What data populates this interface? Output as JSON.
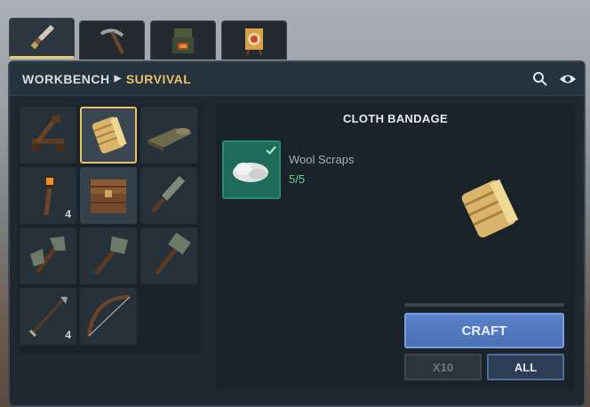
{
  "tabs": [
    {
      "icon": "knife-icon",
      "active": true
    },
    {
      "icon": "pickaxe-icon",
      "active": false
    },
    {
      "icon": "furnace-icon",
      "active": false
    },
    {
      "icon": "target-icon",
      "active": false
    }
  ],
  "breadcrumb": {
    "parent": "WORKBENCH",
    "current": "SURVIVAL"
  },
  "header_icons": [
    "search-icon",
    "eye-icon"
  ],
  "recipe_slots": [
    {
      "item": "catapult",
      "count": ""
    },
    {
      "item": "cloth-bandage",
      "count": "",
      "selected": true
    },
    {
      "item": "bedroll",
      "count": ""
    },
    {
      "item": "torch",
      "count": "4"
    },
    {
      "item": "storage-chest",
      "count": ""
    },
    {
      "item": "stone-knife",
      "count": ""
    },
    {
      "item": "stone-axe",
      "count": ""
    },
    {
      "item": "stone-shovel",
      "count": ""
    },
    {
      "item": "stone-hammer",
      "count": ""
    },
    {
      "item": "arrow",
      "count": "4"
    },
    {
      "item": "bow",
      "count": ""
    }
  ],
  "detail": {
    "title": "CLOTH BANDAGE",
    "ingredient": {
      "name": "Wool Scraps",
      "count": "5/5"
    },
    "craft_label": "CRAFT",
    "qty_x10": "X10",
    "qty_all": "ALL"
  },
  "colors": {
    "accent": "#e8c36a",
    "craft": "#4a6fb5",
    "ok": "#5fd38a"
  }
}
